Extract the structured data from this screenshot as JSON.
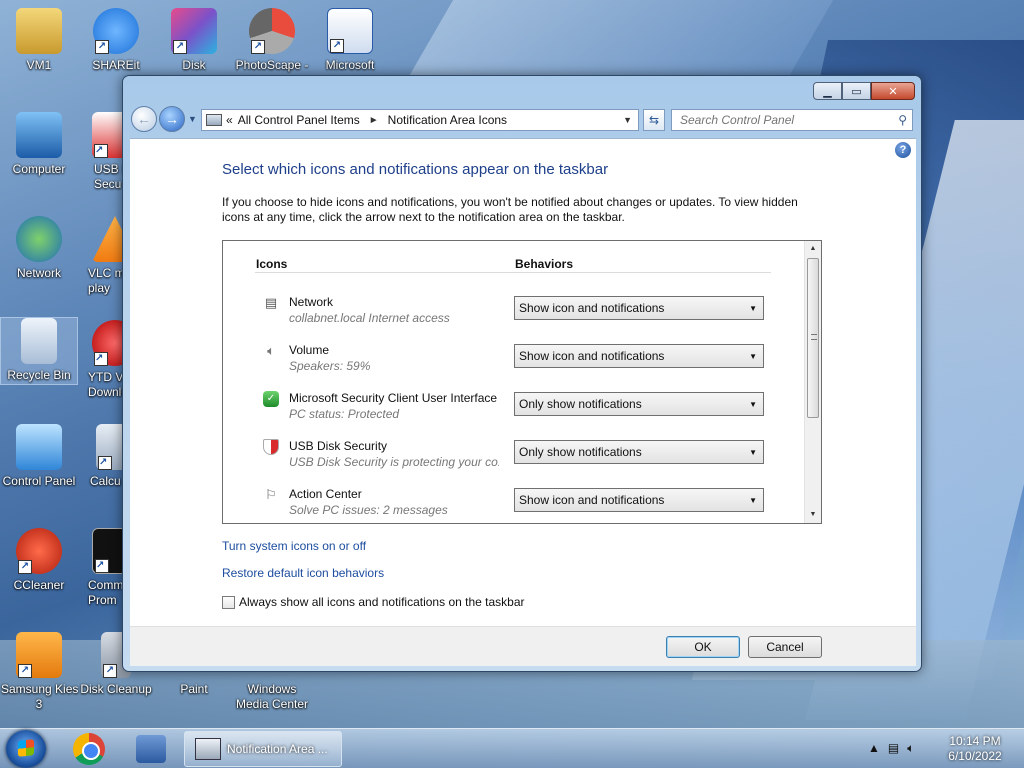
{
  "desktop": {
    "icons": [
      {
        "label": "VM1"
      },
      {
        "label": "SHAREit"
      },
      {
        "label": "Disk"
      },
      {
        "label": "PhotoScape -"
      },
      {
        "label": "Microsoft"
      },
      {
        "label": "Computer"
      },
      {
        "label": "USB D\nSecu"
      },
      {
        "label": "Network"
      },
      {
        "label": "VLC m\nplay"
      },
      {
        "label": "Recycle Bin"
      },
      {
        "label": "YTD V\nDownlo"
      },
      {
        "label": "Control Panel"
      },
      {
        "label": "Calcu"
      },
      {
        "label": "CCleaner"
      },
      {
        "label": "Comm\nProm"
      },
      {
        "label": "Samsung Kies\n3"
      },
      {
        "label": "Disk Cleanup"
      },
      {
        "label": "Paint"
      },
      {
        "label": "Windows\nMedia Center"
      }
    ]
  },
  "window": {
    "address": {
      "overflow": "«",
      "crumbs": [
        "All Control Panel Items",
        "Notification Area Icons"
      ],
      "separator": "►"
    },
    "search_placeholder": "Search Control Panel",
    "help_label": "?",
    "heading": "Select which icons and notifications appear on the taskbar",
    "description": "If you choose to hide icons and notifications, you won't be notified about changes or updates. To view hidden icons at any time, click the arrow next to the notification area on the taskbar.",
    "columns": {
      "icons": "Icons",
      "behaviors": "Behaviors"
    },
    "rows": [
      {
        "name": "Network",
        "status": "collabnet.local Internet access",
        "behavior": "Show icon and notifications",
        "icon": "network-icon"
      },
      {
        "name": "Volume",
        "status": "Speakers: 59%",
        "behavior": "Show icon and notifications",
        "icon": "speaker-icon"
      },
      {
        "name": "Microsoft Security Client User Interface",
        "status": "PC status: Protected",
        "behavior": "Only show notifications",
        "icon": "security-client-icon"
      },
      {
        "name": "USB Disk Security",
        "status": "USB Disk Security is protecting your co...",
        "behavior": "Only show notifications",
        "icon": "usb-disk-security-icon"
      },
      {
        "name": "Action Center",
        "status": "Solve PC issues: 2 messages",
        "behavior": "Show icon and notifications",
        "icon": "flag-icon"
      }
    ],
    "links": {
      "system_icons": "Turn system icons on or off",
      "restore": "Restore default icon behaviors"
    },
    "checkbox_label": "Always show all icons and notifications on the taskbar",
    "ok_label": "OK",
    "cancel_label": "Cancel"
  },
  "taskbar": {
    "active_task": "Notification Area ...",
    "time": "10:14 PM",
    "date": "6/10/2022"
  }
}
